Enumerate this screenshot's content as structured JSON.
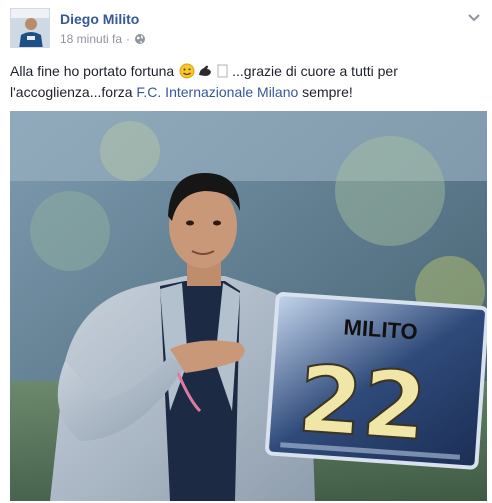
{
  "post": {
    "author_name": "Diego Milito",
    "timestamp": "18 minuti fa",
    "separator": "·",
    "privacy_icon": "globe-icon",
    "menu_icon": "chevron-down-icon",
    "text_part1": "Alla fine ho portato fortuna",
    "emojis": [
      "smile-emoji",
      "flexed-biceps-emoji",
      "missing-glyph"
    ],
    "text_part2": "...grazie di cuore a tutti per l'accoglienza...forza",
    "page_link": "F.C. Internazionale Milano",
    "text_part3": "sempre!",
    "photo": {
      "subject": "man-holding-jersey-plaque",
      "plaque_name": "MILITO",
      "plaque_number": "22"
    }
  },
  "colors": {
    "link": "#365899",
    "text": "#1d2129",
    "meta": "#90949c"
  }
}
